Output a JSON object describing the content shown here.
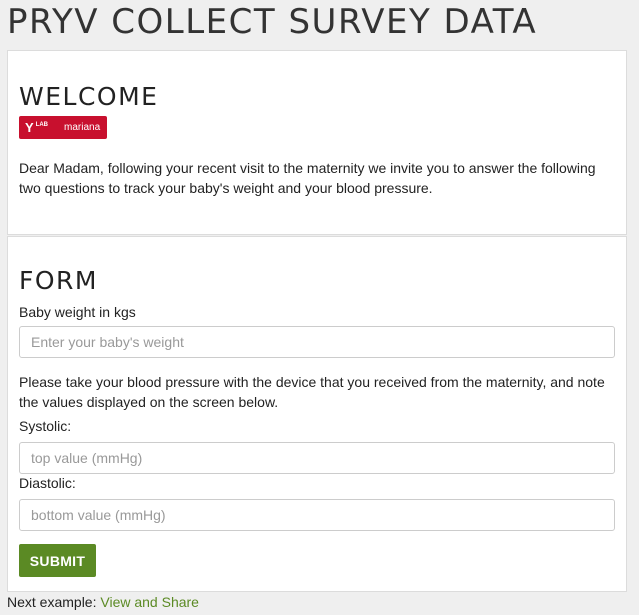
{
  "page_title": "PRYV COLLECT SURVEY DATA",
  "welcome": {
    "heading": "WELCOME",
    "badge": {
      "logo_text": "Y",
      "logo_sup": "LAB",
      "name": "mariana",
      "color": "#c8102e"
    },
    "message": "Dear Madam, following your recent visit to the maternity we invite you to answer the following two questions to track your baby's weight and your blood pressure."
  },
  "form": {
    "heading": "FORM",
    "baby_weight_label": "Baby weight in kgs",
    "baby_weight_placeholder": "Enter your baby's weight",
    "instructions": "Please take your blood pressure with the device that you received from the maternity, and note the values displayed on the screen below.",
    "systolic_label": "Systolic:",
    "systolic_placeholder": "top value (mmHg)",
    "diastolic_label": "Diastolic:",
    "diastolic_placeholder": "bottom value (mmHg)",
    "submit_label": "SUBMIT",
    "submit_color": "#5b8a24"
  },
  "footer": {
    "prefix": "Next example:",
    "link_label": "View and Share",
    "link_color": "#5b8a24"
  }
}
